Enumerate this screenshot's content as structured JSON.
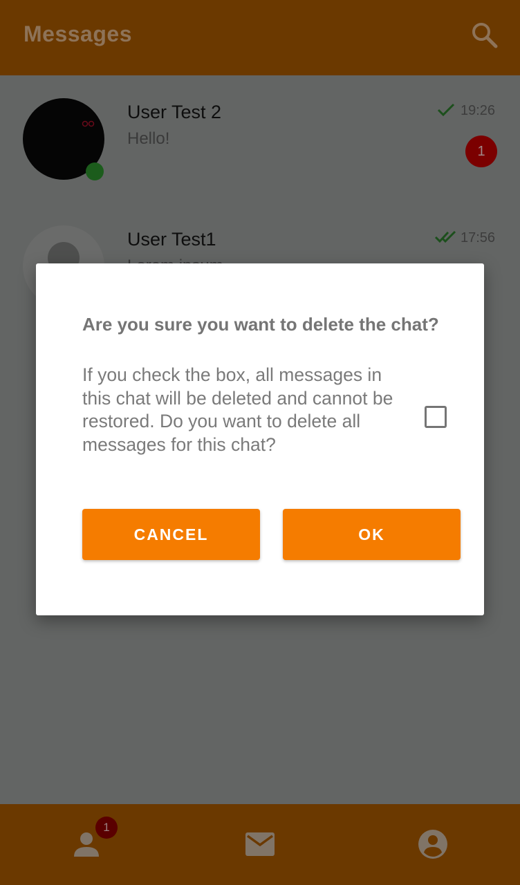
{
  "app_bar": {
    "title": "Messages",
    "search_icon": "search-icon"
  },
  "chats": [
    {
      "name": "User Test 2",
      "preview": "Hello!",
      "time": "19:26",
      "status_icon": "single-check-icon",
      "unread_count": "1",
      "online": true
    },
    {
      "name": "User Test1",
      "preview": "Lorem ipsum",
      "time": "17:56",
      "status_icon": "double-check-icon"
    }
  ],
  "dialog": {
    "title": "Are you sure you want to delete the chat?",
    "message": "If you check the box, all messages in this chat will be deleted and cannot be restored. Do you want to delete all messages for this chat?",
    "checkbox_checked": false,
    "cancel_label": "CANCEL",
    "ok_label": "OK"
  },
  "bottom_nav": {
    "items": [
      {
        "icon": "contacts-icon",
        "badge": "1"
      },
      {
        "icon": "mail-icon"
      },
      {
        "icon": "account-icon"
      }
    ]
  },
  "colors": {
    "brand_orange": "#f57c00",
    "app_bar_dimmed": "#6b3900",
    "badge_red": "#c62828",
    "check_green": "#2e7d32",
    "scrim": "rgba(0,0,0,0.6)"
  }
}
